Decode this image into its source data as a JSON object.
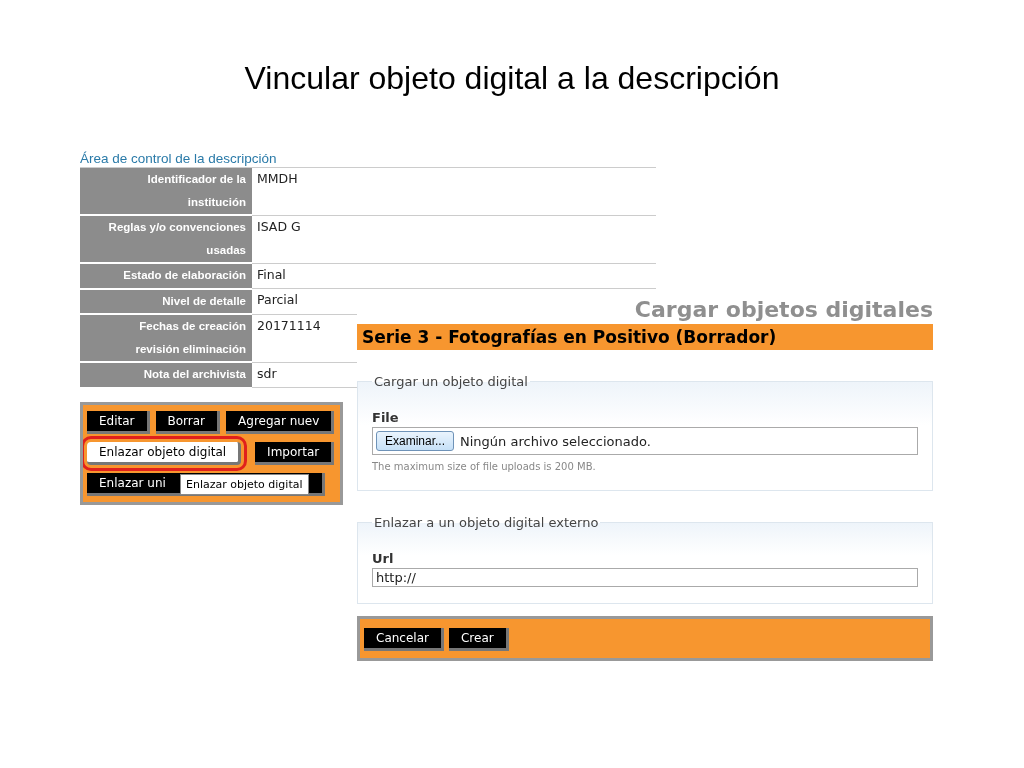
{
  "slide_title": "Vincular objeto digital a la descripción",
  "description_area": {
    "heading": "Área de control de la descripción",
    "rows": [
      {
        "label": "Identificador de la institución",
        "value": "MMDH"
      },
      {
        "label": "Reglas y/o convenciones usadas",
        "value": "ISAD G"
      },
      {
        "label": "Estado de elaboración",
        "value": "Final"
      },
      {
        "label": "Nivel de detalle",
        "value": "Parcial"
      },
      {
        "label": "Fechas de creación revisión eliminación",
        "value": "20171114"
      },
      {
        "label": "Nota del archivista",
        "value": "sdr"
      }
    ],
    "button_rows": [
      [
        {
          "label": "Editar",
          "highlighted": false
        },
        {
          "label": "Borrar",
          "highlighted": false
        },
        {
          "label": "Agregar nuev",
          "highlighted": false
        }
      ],
      [
        {
          "label": "Enlazar objeto digital",
          "highlighted": true
        },
        {
          "label": "Importar",
          "highlighted": false
        }
      ],
      [
        {
          "label": "Enlazar uni",
          "highlighted": false
        }
      ]
    ],
    "tooltip": "Enlazar objeto digital"
  },
  "upload_dialog": {
    "header": "Cargar objetos digitales",
    "title": "Serie 3 - Fotografías en Positivo (Borrador)",
    "fieldsets": [
      {
        "legend": "Cargar un objeto digital",
        "field_label": "File",
        "kind": "file",
        "button": "Examinar...",
        "value": "Ningún archivo seleccionado.",
        "hint": "The maximum size of file uploads is 200 MB."
      },
      {
        "legend": "Enlazar a un objeto digital externo",
        "field_label": "Url",
        "kind": "text",
        "value": "http://"
      }
    ],
    "actions": [
      "Cancelar",
      "Crear"
    ]
  }
}
